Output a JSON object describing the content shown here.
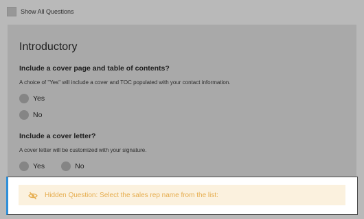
{
  "toolbar": {
    "show_all_label": "Show All Questions"
  },
  "section": {
    "title": "Introductory"
  },
  "questions": [
    {
      "title": "Include a cover page and table of contents?",
      "description": "A choice of \"Yes\" will include a cover and TOC populated with your contact information.",
      "options": [
        "Yes",
        "No"
      ]
    },
    {
      "title": "Include a cover letter?",
      "description": "A cover letter will be customized with your signature.",
      "options": [
        "Yes",
        "No"
      ]
    }
  ],
  "hidden_question": {
    "icon": "eye-slash-icon",
    "text": "Hidden Question: Select the sales rep name from the list:",
    "accent_color": "#2f8fd8",
    "text_color": "#e6ad4e",
    "background_color": "#fbf1de"
  }
}
